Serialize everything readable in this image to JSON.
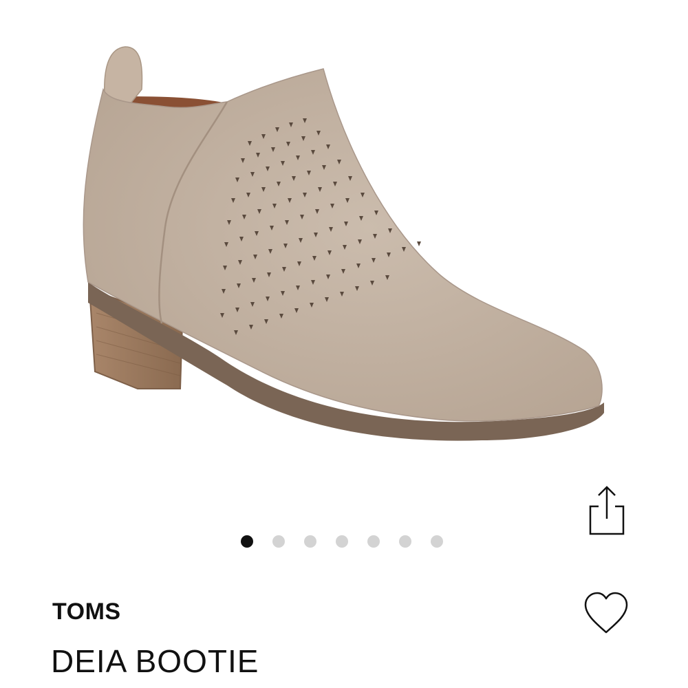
{
  "product": {
    "brand": "TOMS",
    "name": "DEIA BOOTIE",
    "image_alt": "taupe suede perforated ankle bootie"
  },
  "gallery": {
    "total_images": 7,
    "active_index": 0
  },
  "colors": {
    "suede": "#c2b1a1",
    "sole": "#7a6555",
    "heel_wood": "#9a7758",
    "lining": "#8a5034",
    "dot_active": "#111111",
    "dot_inactive": "#d3d3d3"
  },
  "icons": {
    "share": "share-icon",
    "favorite": "heart-icon"
  }
}
